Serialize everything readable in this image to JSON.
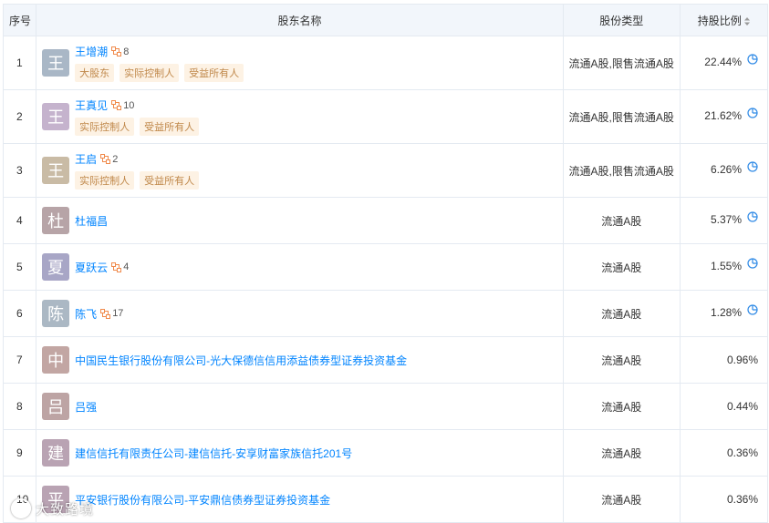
{
  "header": {
    "index": "序号",
    "name": "股东名称",
    "type": "股份类型",
    "ratio": "持股比例"
  },
  "rows": [
    {
      "index": "1",
      "avatar": "王",
      "avatar_color": "#a9b7c6",
      "name": "王增潮",
      "rel_count": "8",
      "tags": [
        "大股东",
        "实际控制人",
        "受益所有人"
      ],
      "type": "流通A股,限售流通A股",
      "ratio": "22.44%",
      "has_chart": true
    },
    {
      "index": "2",
      "avatar": "王",
      "avatar_color": "#c5b3cd",
      "name": "王真见",
      "rel_count": "10",
      "tags": [
        "实际控制人",
        "受益所有人"
      ],
      "type": "流通A股,限售流通A股",
      "ratio": "21.62%",
      "has_chart": true
    },
    {
      "index": "3",
      "avatar": "王",
      "avatar_color": "#c9bba5",
      "name": "王启",
      "rel_count": "2",
      "tags": [
        "实际控制人",
        "受益所有人"
      ],
      "type": "流通A股,限售流通A股",
      "ratio": "6.26%",
      "has_chart": true
    },
    {
      "index": "4",
      "avatar": "杜",
      "avatar_color": "#b7a4a7",
      "name": "杜福昌",
      "rel_count": "",
      "tags": [],
      "type": "流通A股",
      "ratio": "5.37%",
      "has_chart": true
    },
    {
      "index": "5",
      "avatar": "夏",
      "avatar_color": "#a8a6c6",
      "name": "夏跃云",
      "rel_count": "4",
      "tags": [],
      "type": "流通A股",
      "ratio": "1.55%",
      "has_chart": true
    },
    {
      "index": "6",
      "avatar": "陈",
      "avatar_color": "#abb8c4",
      "name": "陈飞",
      "rel_count": "17",
      "tags": [],
      "type": "流通A股",
      "ratio": "1.28%",
      "has_chart": true
    },
    {
      "index": "7",
      "avatar": "中",
      "avatar_color": "#c2a6a3",
      "name": "中国民生银行股份有限公司-光大保德信信用添益债券型证券投资基金",
      "rel_count": "",
      "tags": [],
      "type": "流通A股",
      "ratio": "0.96%",
      "has_chart": false
    },
    {
      "index": "8",
      "avatar": "吕",
      "avatar_color": "#bda4a4",
      "name": "吕强",
      "rel_count": "",
      "tags": [],
      "type": "流通A股",
      "ratio": "0.44%",
      "has_chart": false
    },
    {
      "index": "9",
      "avatar": "建",
      "avatar_color": "#b9a3b3",
      "name": "建信信托有限责任公司-建信信托-安享财富家族信托201号",
      "rel_count": "",
      "tags": [],
      "type": "流通A股",
      "ratio": "0.36%",
      "has_chart": false
    },
    {
      "index": "10",
      "avatar": "平",
      "avatar_color": "#b9a3b3",
      "name": "平安银行股份有限公司-平安鼎信债券型证券投资基金",
      "rel_count": "",
      "tags": [],
      "type": "流通A股",
      "ratio": "0.36%",
      "has_chart": false
    }
  ],
  "watermark": "大致路境"
}
